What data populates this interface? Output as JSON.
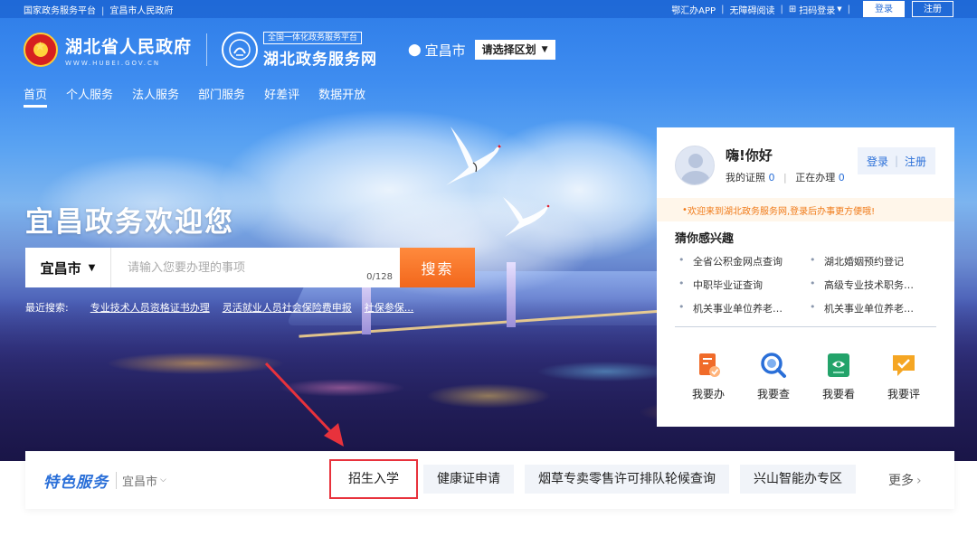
{
  "topbar": {
    "left_links": [
      "国家政务服务平台",
      "宜昌市人民政府"
    ],
    "right_links": [
      "鄂汇办APP",
      "无障碍阅读",
      "扫码登录"
    ],
    "scan_icon": "qr-icon",
    "login": "登录",
    "register": "注册"
  },
  "header": {
    "gov_title": "湖北省人民政府",
    "gov_url": "WWW.HUBEI.GOV.CN",
    "platform_tag": "全国一体化政务服务平台",
    "platform_name": "湖北政务服务网",
    "location": "宜昌市",
    "region_select": "请选择区划"
  },
  "nav": {
    "items": [
      "首页",
      "个人服务",
      "法人服务",
      "部门服务",
      "好差评",
      "数据开放"
    ],
    "active_index": 0
  },
  "hero": {
    "welcome": "宜昌政务欢迎您"
  },
  "search": {
    "city": "宜昌市",
    "placeholder": "请输入您要办理的事项",
    "counter": "0/128",
    "button": "搜索",
    "recent_label": "最近搜索:",
    "recent": [
      "专业技术人员资格证书办理",
      "灵活就业人员社会保险费申报",
      "社保参保..."
    ]
  },
  "panel": {
    "greeting": "嗨!你好",
    "cert_label": "我的证照",
    "cert_count": "0",
    "doing_label": "正在办理",
    "doing_count": "0",
    "login": "登录",
    "register": "注册",
    "notice": "欢迎来到湖北政务服务网,登录后办事更方便哦!",
    "interest_title": "猜你感兴趣",
    "interests": [
      "全省公积金网点查询",
      "湖北婚姻预约登记",
      "中职毕业证查询",
      "高级专业技术职务…",
      "机关事业单位养老…",
      "机关事业单位养老…"
    ],
    "actions": [
      {
        "label": "我要办",
        "icon": "apply-doc-icon",
        "color": "#f06b2a"
      },
      {
        "label": "我要查",
        "icon": "search-magnifier-icon",
        "color": "#2a6fd8"
      },
      {
        "label": "我要看",
        "icon": "view-eye-icon",
        "color": "#23a36a"
      },
      {
        "label": "我要评",
        "icon": "rate-chat-icon",
        "color": "#f5a623"
      }
    ]
  },
  "feature": {
    "title": "特色服务",
    "city": "宜昌市",
    "chips": [
      "招生入学",
      "健康证申请",
      "烟草专卖零售许可排队轮候查询",
      "兴山智能办专区"
    ],
    "highlight_index": 0,
    "more": "更多"
  },
  "colors": {
    "brand_blue": "#2a6fd8",
    "search_orange": "#f2671c",
    "highlight_red": "#e8323c"
  }
}
